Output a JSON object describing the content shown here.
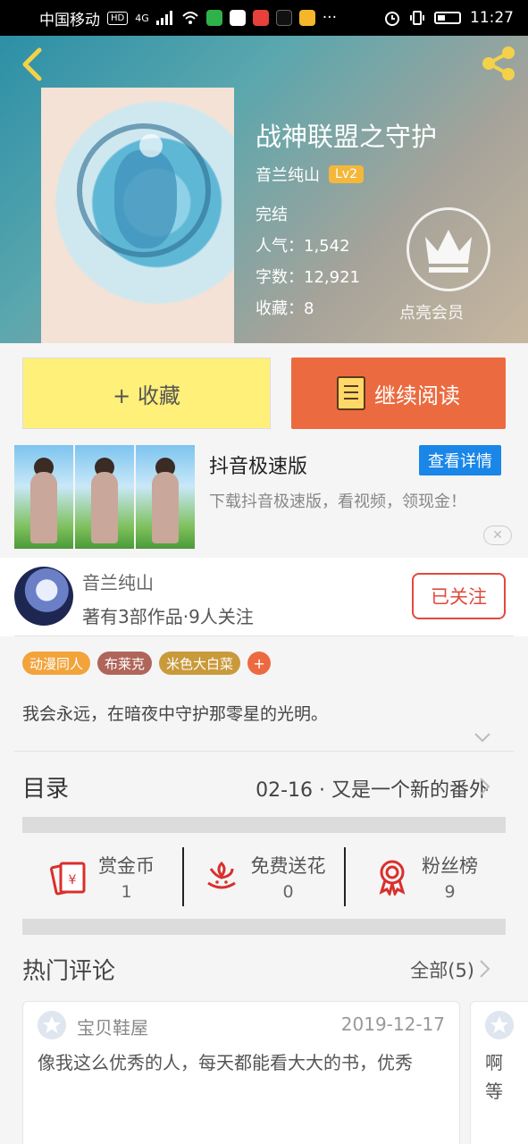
{
  "status_bar": {
    "carrier": "中国移动",
    "hd": "HD",
    "signal": "4G",
    "more": "···",
    "time": "11:27"
  },
  "book": {
    "title": "战神联盟之守护",
    "author": "音兰纯山",
    "level": "Lv2",
    "status": "完结",
    "popularity": "人气：1,542",
    "words": "字数：12,921",
    "favorites": "收藏：8",
    "vip_label": "点亮会员"
  },
  "actions": {
    "collect_label": "+ 收藏",
    "read_label": "继续阅读"
  },
  "ad": {
    "title": "抖音极速版",
    "button": "查看详情",
    "description": "下载抖音极速版，看视频，领现金！",
    "close": "✕"
  },
  "author_card": {
    "name": "音兰纯山",
    "summary": "著有3部作品·9人关注",
    "follow_label": "已关注"
  },
  "tags": [
    {
      "label": "动漫同人",
      "color": "#f2a33a"
    },
    {
      "label": "布莱克",
      "color": "#b0655a"
    },
    {
      "label": "米色大白菜",
      "color": "#c99a3b"
    }
  ],
  "tag_add": "+",
  "intro": "我会永远，在暗夜中守护那零星的光明。",
  "catalog": {
    "title": "目录",
    "latest": "02-16 · 又是一个新的番外"
  },
  "stats": [
    {
      "label": "赏金币",
      "value": "1",
      "icon": "red-envelope-icon"
    },
    {
      "label": "免费送花",
      "value": "0",
      "icon": "flower-icon"
    },
    {
      "label": "粉丝榜",
      "value": "9",
      "icon": "medal-icon"
    }
  ],
  "comments": {
    "title": "热门评论",
    "all_label": "全部(5)",
    "items": [
      {
        "user": "宝贝鞋屋",
        "date": "2019-12-17",
        "text": "像我这么优秀的人，每天都能看大大的书，优秀"
      },
      {
        "user": "",
        "date": "",
        "text": "啊\n等"
      }
    ]
  },
  "colors": {
    "accent_orange": "#ec6a3f",
    "collect_yellow": "#fff07a",
    "follow_red": "#e2493c",
    "ad_blue": "#1a86e8",
    "level_badge": "#f4b73a"
  }
}
